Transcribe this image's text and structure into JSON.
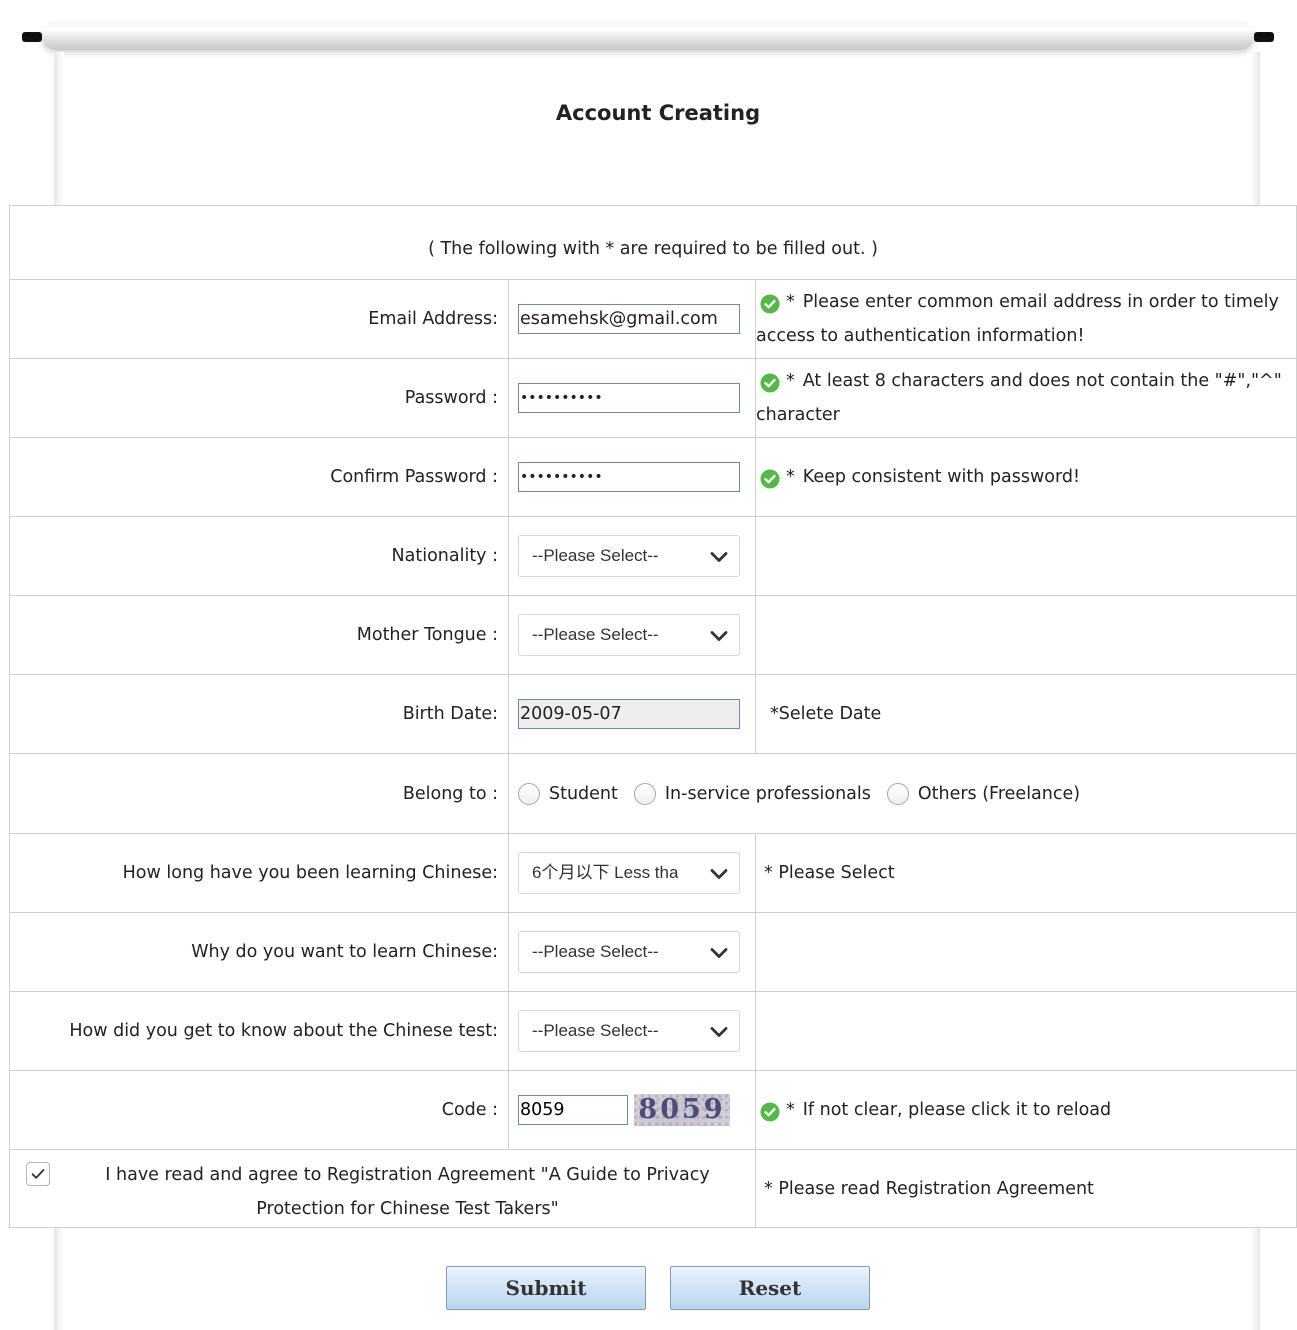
{
  "page": {
    "title": "Account Creating",
    "required_note": "( The following with * are required to be filled out. )"
  },
  "form": {
    "email": {
      "label": "Email Address:",
      "value": "esamehsk@gmail.com",
      "hint_star": "*",
      "hint": "Please enter common email address in order to timely access to authentication information!"
    },
    "password": {
      "label": "Password :",
      "value": "••••••••••",
      "hint_star": "*",
      "hint": "At least 8 characters and does not contain the \"#\",\"^\" character"
    },
    "confirm_password": {
      "label": "Confirm Password :",
      "value": "••••••••••",
      "hint_star": "*",
      "hint": "Keep consistent with password!"
    },
    "nationality": {
      "label": "Nationality :",
      "selected": "--Please Select--"
    },
    "mother_tongue": {
      "label": "Mother Tongue :",
      "selected": "--Please Select--"
    },
    "birth_date": {
      "label": "Birth Date:",
      "value": "2009-05-07",
      "hint": "*Selete Date"
    },
    "belong_to": {
      "label": "Belong to :",
      "options": [
        "Student",
        "In-service professionals",
        "Others (Freelance)"
      ]
    },
    "learning_duration": {
      "label": "How long have you been learning Chinese:",
      "selected": "6个月以下 Less tha",
      "hint": "* Please Select"
    },
    "learn_reason": {
      "label": "Why do you want to learn Chinese:",
      "selected": "--Please Select--"
    },
    "know_about_test": {
      "label": "How did you get to know about the Chinese test:",
      "selected": "--Please Select--"
    },
    "code": {
      "label": "Code :",
      "value": "8059",
      "captcha_text": "8059",
      "hint_star": "*",
      "hint": "If not clear, please click it to reload"
    },
    "agreement": {
      "checked": true,
      "text": "I have read and agree to Registration Agreement  \"A Guide to Privacy Protection for Chinese Test Takers\"",
      "hint": "*  Please read Registration Agreement"
    }
  },
  "buttons": {
    "submit": "Submit",
    "reset": "Reset"
  },
  "colors": {
    "check_icon": "#55b848",
    "input_border": "#6d8aa8",
    "button_gradient_top": "#eaf3fc",
    "button_gradient_bottom": "#bcd6f0"
  }
}
